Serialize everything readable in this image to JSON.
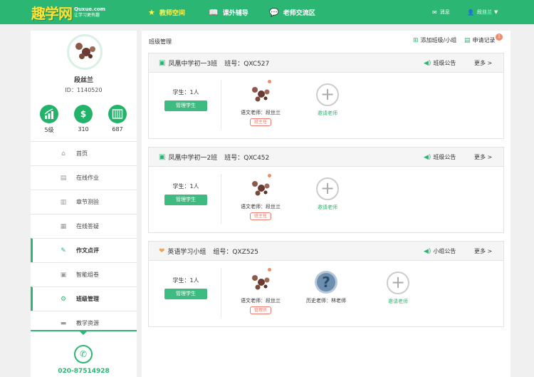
{
  "header": {
    "logo_text": "趣学网",
    "logo_site": "Quxue.com",
    "logo_slogan": "让学习更有趣",
    "nav": [
      {
        "label": "教师空间",
        "icon": "star-icon",
        "active": true
      },
      {
        "label": "课外辅导",
        "icon": "book-icon",
        "active": false
      },
      {
        "label": "老师交流区",
        "icon": "chat-icon",
        "active": false
      }
    ],
    "messages_label": "消息",
    "user_label": "段丝兰"
  },
  "profile": {
    "name": "段丝兰",
    "id_text": "ID：1140520",
    "stats": [
      {
        "icon": "level-chart-icon",
        "value": "5级"
      },
      {
        "icon": "money-bag-icon",
        "value": "310"
      },
      {
        "icon": "abacus-icon",
        "value": "687"
      }
    ]
  },
  "menu": [
    {
      "label": "首页",
      "icon": "home-icon",
      "highlight": false
    },
    {
      "label": "在线作业",
      "icon": "document-icon",
      "highlight": false
    },
    {
      "label": "章节测验",
      "icon": "map-icon",
      "highlight": false
    },
    {
      "label": "在线答疑",
      "icon": "qa-icon",
      "highlight": false
    },
    {
      "label": "作文点评",
      "icon": "edit-icon",
      "highlight": true
    },
    {
      "label": "智能组卷",
      "icon": "paper-icon",
      "highlight": false
    },
    {
      "label": "班级管理",
      "icon": "settings-icon",
      "highlight": true
    },
    {
      "label": "教学资源",
      "icon": "folder-icon",
      "highlight": false
    }
  ],
  "phone": "020-87514928",
  "main": {
    "breadcrumb": "班级管理",
    "add_label": "添加班级/小组",
    "apply_label": "申请记录",
    "apply_badge": "1",
    "cards": [
      {
        "name": "凤凰中学初一3班",
        "code": "班号：QXC527",
        "announce": "班级公告",
        "more": "更多 >",
        "students": "学生：1人",
        "manage": "管理学生",
        "teachers": [
          {
            "name": "语文老师：段丝兰",
            "role": "班主任"
          }
        ],
        "invite": "邀请老师"
      },
      {
        "name": "凤凰中学初一2班",
        "code": "班号：QXC452",
        "announce": "班级公告",
        "more": "更多 >",
        "students": "学生：1人",
        "manage": "管理学生",
        "teachers": [
          {
            "name": "语文老师：段丝兰",
            "role": "班主任"
          }
        ],
        "invite": "邀请老师"
      },
      {
        "name": "英语学习小组",
        "code": "组号：QXZ525",
        "announce": "小组公告",
        "more": "更多 >",
        "students": "学生：1人",
        "manage": "管理学生",
        "teachers": [
          {
            "name": "语文老师：段丝兰",
            "role": "管理员"
          },
          {
            "name": "历史老师：林老师",
            "role": ""
          }
        ],
        "invite": "邀请老师"
      }
    ]
  },
  "colors": {
    "brand": "#2bb673",
    "nav_active": "#fff34d",
    "badge": "#f28b6b",
    "tag": "#f0786c"
  }
}
